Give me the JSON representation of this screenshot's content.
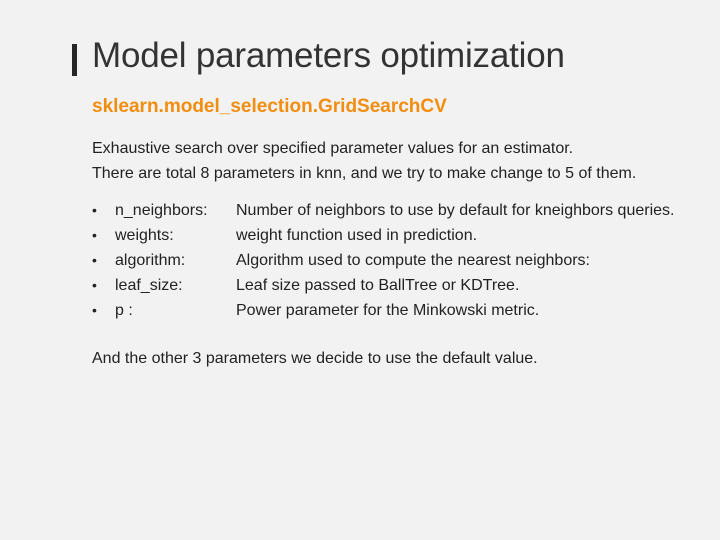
{
  "title": "Model parameters optimization",
  "subtitle": "sklearn.model_selection.GridSearchCV",
  "description": [
    "Exhaustive search over specified parameter values for an estimator.",
    "There are total 8 parameters in knn, and we try to make change to 5 of them."
  ],
  "bullet_symbol": "•",
  "parameters": [
    {
      "name": "n_neighbors:",
      "desc": "Number of neighbors to use by default for kneighbors queries."
    },
    {
      "name": "weights:",
      "desc": "weight function used in prediction."
    },
    {
      "name": "algorithm:",
      "desc": "Algorithm used to compute the nearest neighbors:"
    },
    {
      "name": "leaf_size:",
      "desc": "Leaf size passed to BallTree or KDTree."
    },
    {
      "name": "p :",
      "desc": "Power parameter for the Minkowski metric."
    }
  ],
  "footer": "And the other 3 parameters we decide to use the default value.",
  "colors": {
    "accent": "#f28e0f",
    "title": "#333333",
    "text": "#222222",
    "background": "#f2f2f2",
    "title_marker": "#262626"
  }
}
